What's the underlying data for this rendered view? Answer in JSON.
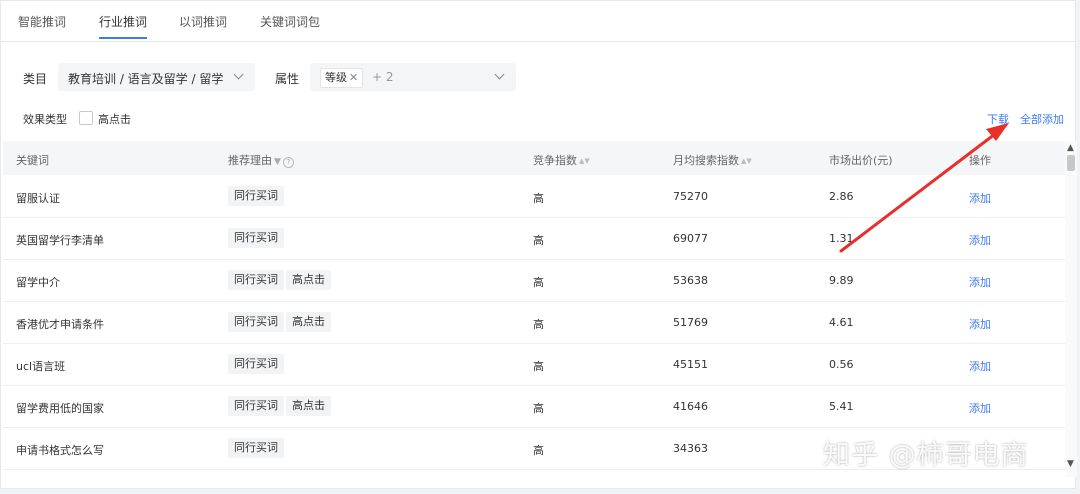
{
  "tabs": [
    {
      "label": "智能推词",
      "active": false
    },
    {
      "label": "行业推词",
      "active": true
    },
    {
      "label": "以词推词",
      "active": false
    },
    {
      "label": "关键词词包",
      "active": false
    }
  ],
  "filters": {
    "category_label": "类目",
    "category_value": "教育培训 / 语言及留学 / 留学",
    "attribute_label": "属性",
    "attribute_tag": "等级",
    "attribute_more": "+ 2",
    "effect_label": "效果类型",
    "effect_option": "高点击"
  },
  "actions": {
    "download": "下载",
    "add_all": "全部添加"
  },
  "table": {
    "headers": [
      "关键词",
      "推荐理由",
      "竞争指数",
      "月均搜索指数",
      "市场出价(元)",
      "操作"
    ],
    "rows": [
      {
        "keyword": "留服认证",
        "reasons": [
          "同行买词"
        ],
        "competition": "高",
        "search": "75270",
        "price": "2.86",
        "op": "添加"
      },
      {
        "keyword": "英国留学行李清单",
        "reasons": [
          "同行买词"
        ],
        "competition": "高",
        "search": "69077",
        "price": "1.31",
        "op": "添加"
      },
      {
        "keyword": "留学中介",
        "reasons": [
          "同行买词",
          "高点击"
        ],
        "competition": "高",
        "search": "53638",
        "price": "9.89",
        "op": "添加"
      },
      {
        "keyword": "香港优才申请条件",
        "reasons": [
          "同行买词",
          "高点击"
        ],
        "competition": "高",
        "search": "51769",
        "price": "4.61",
        "op": "添加"
      },
      {
        "keyword": "ucl语言班",
        "reasons": [
          "同行买词"
        ],
        "competition": "高",
        "search": "45151",
        "price": "0.56",
        "op": "添加"
      },
      {
        "keyword": "留学费用低的国家",
        "reasons": [
          "同行买词",
          "高点击"
        ],
        "competition": "高",
        "search": "41646",
        "price": "5.41",
        "op": "添加"
      },
      {
        "keyword": "申请书格式怎么写",
        "reasons": [
          "同行买词"
        ],
        "competition": "高",
        "search": "34363",
        "price": "",
        "op": ""
      }
    ]
  },
  "watermark": "知乎 @柿哥电商",
  "colors": {
    "accent": "#3c7bf0",
    "annotation_arrow": "#e8302a"
  }
}
